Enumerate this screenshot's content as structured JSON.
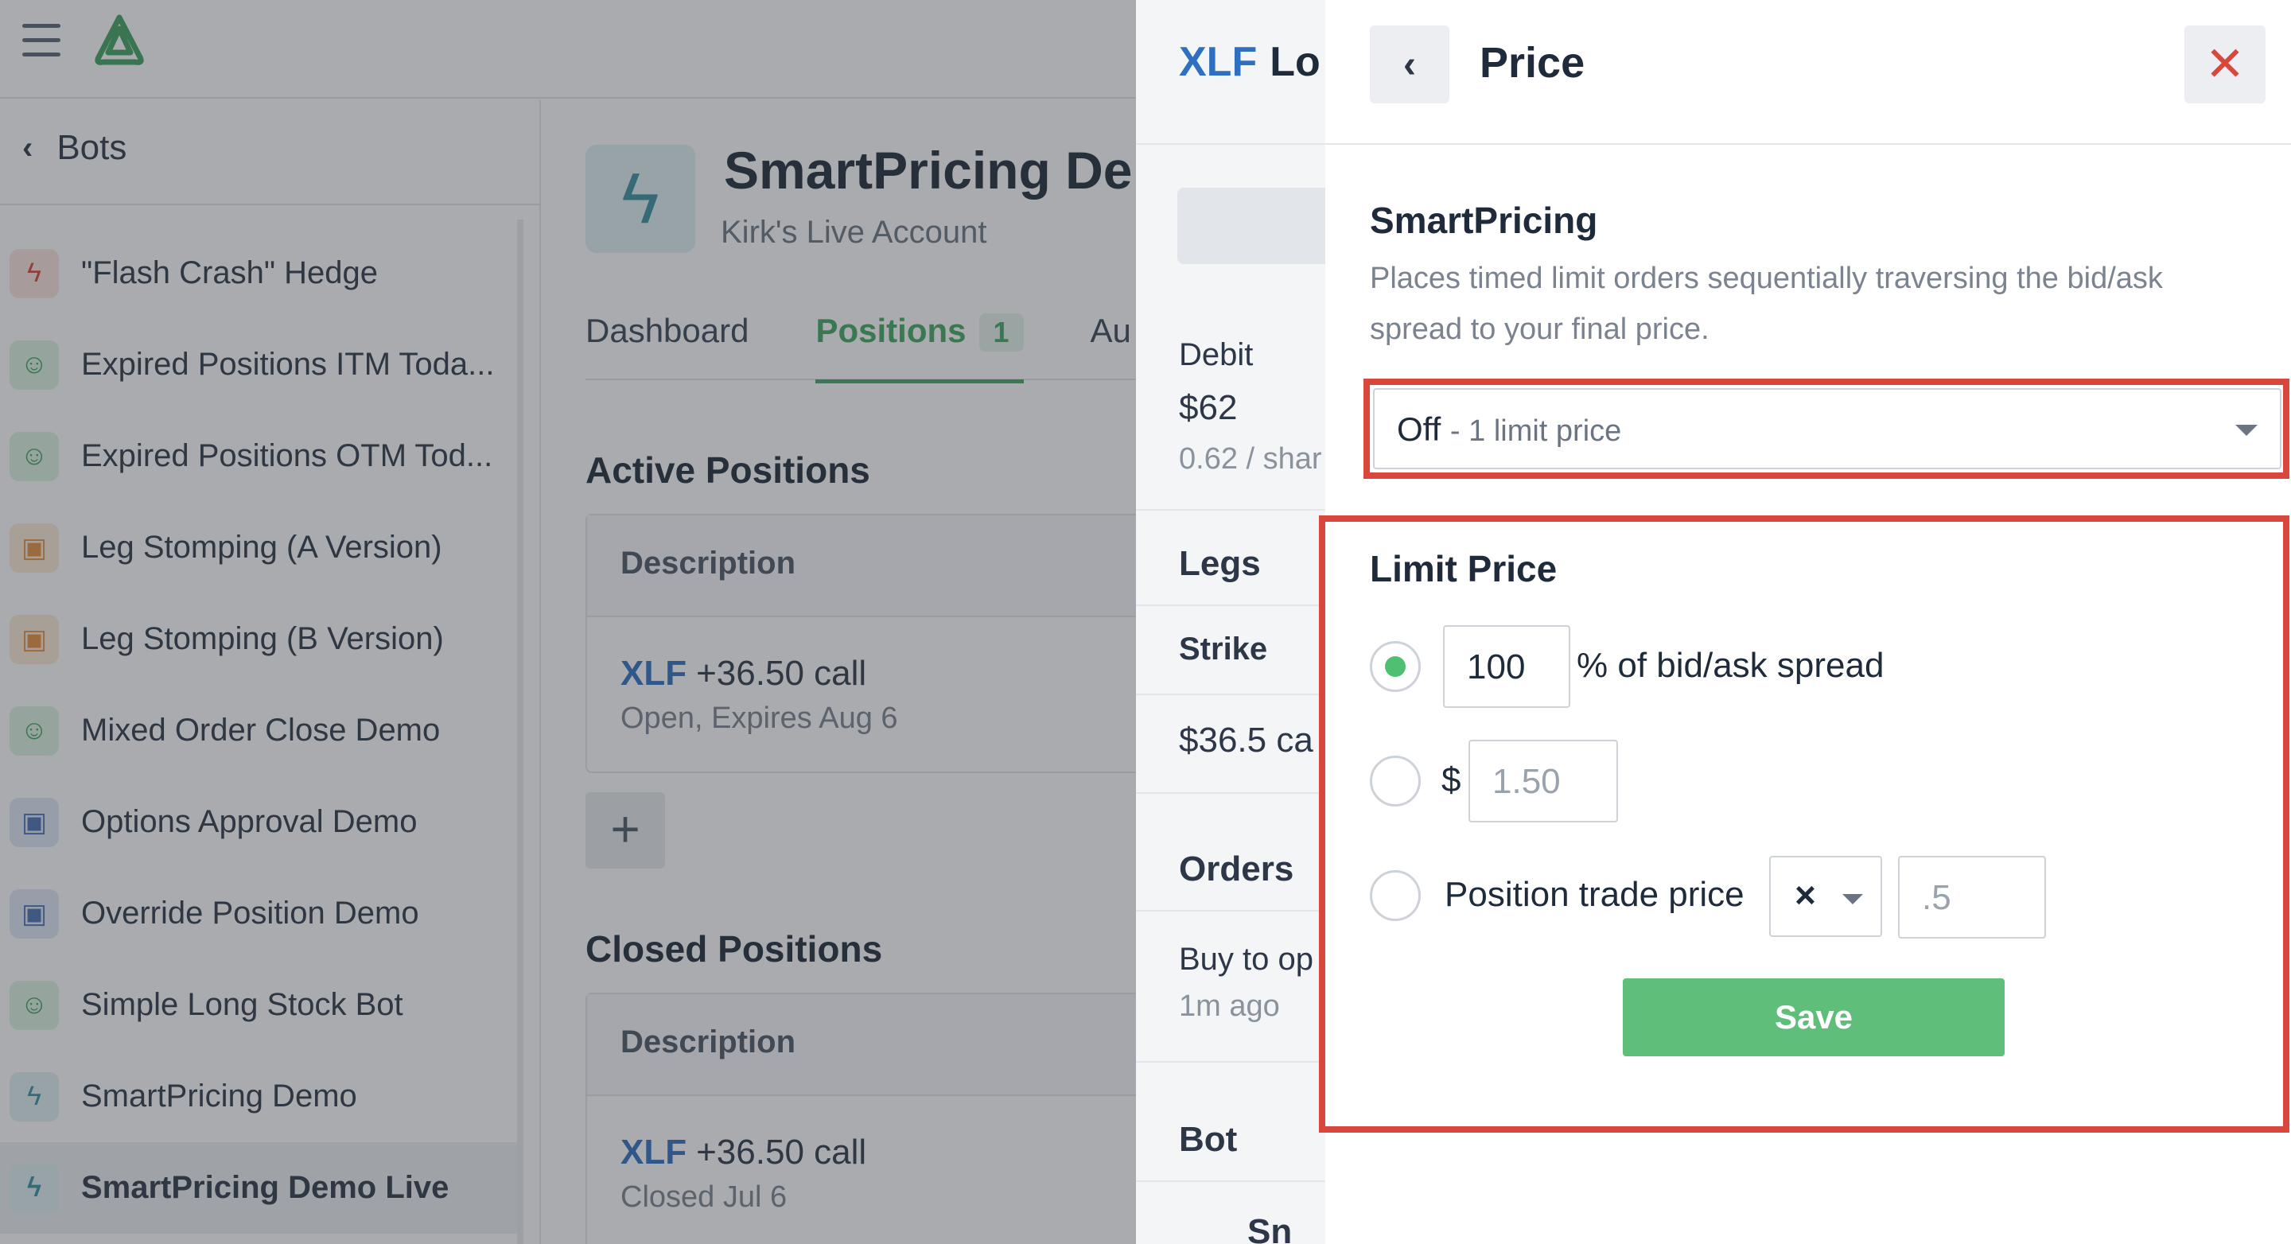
{
  "sidebar": {
    "back_label": "Bots",
    "items": [
      {
        "label": "\"Flash Crash\" Hedge",
        "icon": "bolt-icon",
        "color": "red"
      },
      {
        "label": "Expired Positions ITM Toda...",
        "icon": "bot-face-icon",
        "color": "green"
      },
      {
        "label": "Expired Positions OTM Tod...",
        "icon": "bot-face-icon",
        "color": "green"
      },
      {
        "label": "Leg Stomping (A Version)",
        "icon": "robot-icon",
        "color": "orange"
      },
      {
        "label": "Leg Stomping (B Version)",
        "icon": "robot-icon",
        "color": "orange"
      },
      {
        "label": "Mixed Order Close Demo",
        "icon": "bot-face-icon",
        "color": "green"
      },
      {
        "label": "Options Approval Demo",
        "icon": "robot-icon",
        "color": "blue"
      },
      {
        "label": "Override Position Demo",
        "icon": "robot-icon",
        "color": "blue"
      },
      {
        "label": "Simple Long Stock Bot",
        "icon": "bot-face-icon",
        "color": "green"
      },
      {
        "label": "SmartPricing Demo",
        "icon": "bolt-icon",
        "color": "teal"
      },
      {
        "label": "SmartPricing Demo Live",
        "icon": "bolt-icon",
        "color": "teal",
        "active": true
      }
    ]
  },
  "bot": {
    "title": "SmartPricing De",
    "account": "Kirk's Live Account"
  },
  "tabs": {
    "dashboard": "Dashboard",
    "positions": "Positions",
    "positions_count": "1",
    "third": "Au"
  },
  "active_positions": {
    "title": "Active Positions",
    "col_description": "Description",
    "row": {
      "ticker": "XLF",
      "desc": "+36.50 call",
      "sub": "Open, Expires Aug 6"
    }
  },
  "closed_positions": {
    "title": "Closed Positions",
    "col_description": "Description",
    "row": {
      "ticker": "XLF",
      "desc": "+36.50 call",
      "sub": "Closed Jul 6"
    }
  },
  "add_button": "+",
  "drawer": {
    "ticker": "XLF",
    "title": "Lo",
    "debit_label": "Debit",
    "debit_value": "$62",
    "debit_per_share": "0.62 / shar",
    "legs_label": "Legs",
    "strike_label": "Strike",
    "strike_value": "$36.5 ca",
    "orders_label": "Orders",
    "order_text": "Buy to op",
    "order_time": "1m ago",
    "bot_label": "Bot",
    "bot_partial": "Sn"
  },
  "price_panel": {
    "back_icon": "chevron-left-icon",
    "title": "Price",
    "close_icon": "close-icon",
    "smartpricing_title": "SmartPricing",
    "smartpricing_desc": "Places timed limit orders sequentially traversing the bid/ask spread to your final price.",
    "select_value": "Off",
    "select_detail": "- 1 limit price",
    "limit_price_title": "Limit Price",
    "option1_value": "100",
    "option1_label": "% of bid/ask spread",
    "option2_prefix": "$",
    "option2_placeholder": "1.50",
    "option3_label": "Position trade price",
    "option3_operator": "×",
    "option3_placeholder": ".5",
    "save_label": "Save"
  },
  "colors": {
    "accent_green": "#5fbe7a",
    "ticker_blue": "#2f6fbf",
    "highlight_red": "#d9473c"
  }
}
